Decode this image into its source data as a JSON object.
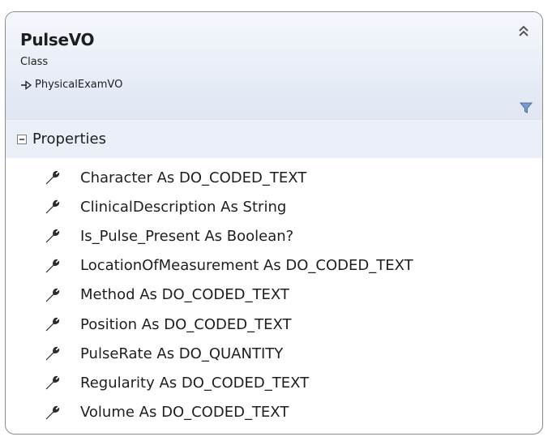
{
  "class": {
    "name": "PulseVO",
    "stereotype": "Class",
    "base_class": "PhysicalExamVO"
  },
  "icons": {
    "collapse": "double-chevron-up-icon",
    "filter": "filter-icon",
    "inheritance": "inheritance-arrow-icon",
    "property": "wrench-icon",
    "expander": "minus-box-icon"
  },
  "section": {
    "label": "Properties",
    "expanded": true
  },
  "properties": [
    "Character As DO_CODED_TEXT",
    "ClinicalDescription As String",
    "Is_Pulse_Present As Boolean?",
    "LocationOfMeasurement As DO_CODED_TEXT",
    "Method As DO_CODED_TEXT",
    "Position As DO_CODED_TEXT",
    "PulseRate As DO_QUANTITY",
    "Regularity As DO_CODED_TEXT",
    "Volume As DO_CODED_TEXT"
  ],
  "colors": {
    "header_top": "#f4f7fc",
    "header_bottom": "#dfe6f2",
    "section_bg": "#ebeff7",
    "border": "#8a8a8a",
    "filter_icon": "#5b7fb3"
  }
}
